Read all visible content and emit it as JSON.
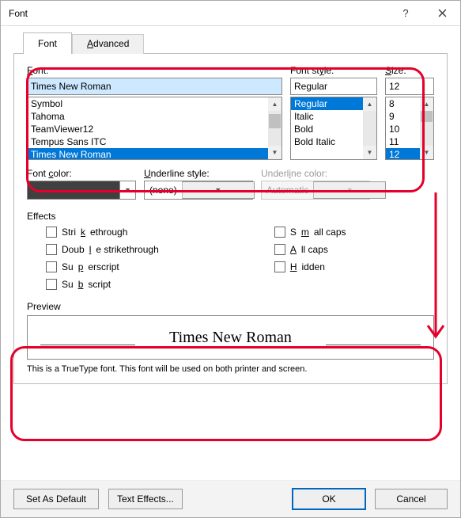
{
  "title": "Font",
  "tabs": {
    "font": "Font",
    "advanced": "Advanced"
  },
  "labels": {
    "font": "Font:",
    "style": "Font style:",
    "size": "Size:",
    "color": "Font color:",
    "underline": "Underline style:",
    "ucolor": "Underline color:",
    "effects": "Effects",
    "preview": "Preview"
  },
  "values": {
    "font_input": "Times New Roman",
    "style_input": "Regular",
    "size_input": "12",
    "underline_style": "(none)",
    "ucolor_value": "Automatic"
  },
  "font_list": [
    "Symbol",
    "Tahoma",
    "TeamViewer12",
    "Tempus Sans ITC",
    "Times New Roman"
  ],
  "style_list": [
    "Regular",
    "Italic",
    "Bold",
    "Bold Italic"
  ],
  "size_list": [
    "8",
    "9",
    "10",
    "11",
    "12"
  ],
  "effects_left": [
    "Strikethrough",
    "Double strikethrough",
    "Superscript",
    "Subscript"
  ],
  "effects_right": [
    "Small caps",
    "All caps",
    "Hidden"
  ],
  "preview_text": "Times New Roman",
  "preview_note": "This is a TrueType font. This font will be used on both printer and screen.",
  "buttons": {
    "default": "Set As Default",
    "texteffects": "Text Effects...",
    "ok": "OK",
    "cancel": "Cancel"
  }
}
